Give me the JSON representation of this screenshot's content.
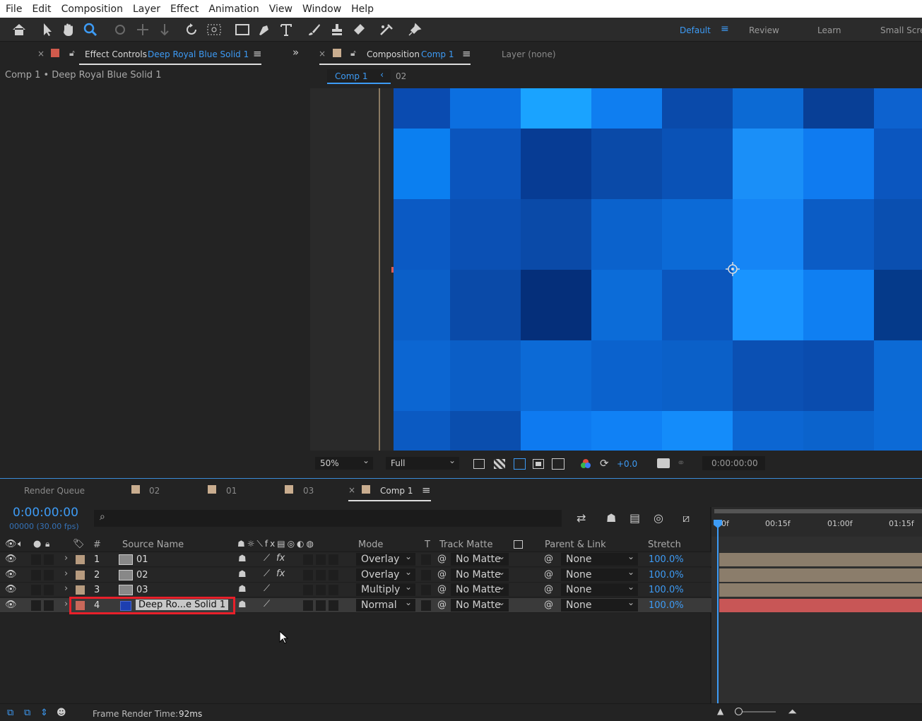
{
  "menu": [
    "File",
    "Edit",
    "Composition",
    "Layer",
    "Effect",
    "Animation",
    "View",
    "Window",
    "Help"
  ],
  "workspaces": {
    "default": "Default",
    "review": "Review",
    "learn": "Learn",
    "small_screen": "Small Scre"
  },
  "effect_controls": {
    "tab_label": "Effect Controls",
    "tab_layer": "Deep Royal Blue Solid 1",
    "breadcrumb": "Comp 1 • Deep Royal Blue Solid 1"
  },
  "composition": {
    "tab_label": "Composition",
    "tab_comp": "Comp 1",
    "layer_tab": "Layer (none)",
    "crumb_active": "Comp 1",
    "crumb_next": "02",
    "zoom": "50%",
    "resolution": "Full",
    "exposure": "+0.0",
    "timecode": "0:00:00:00"
  },
  "timeline": {
    "tabs": [
      "Render Queue",
      "02",
      "01",
      "03",
      "Comp 1"
    ],
    "timecode": "0:00:00:00",
    "frames": "00000 (30.00 fps)",
    "search_placeholder": "⌕",
    "ruler": [
      "0f",
      "00:15f",
      "01:00f",
      "01:15f"
    ],
    "columns": {
      "hash": "#",
      "source": "Source Name",
      "mode": "Mode",
      "t": "T",
      "track_matte": "Track Matte",
      "parent": "Parent & Link",
      "stretch": "Stretch"
    },
    "layers": [
      {
        "num": "1",
        "name": "01",
        "mode": "Overlay",
        "matte": "No Matte",
        "parent": "None",
        "stretch": "100.0%",
        "label_color": "#b79b7f",
        "fx": "fx"
      },
      {
        "num": "2",
        "name": "02",
        "mode": "Overlay",
        "matte": "No Matte",
        "parent": "None",
        "stretch": "100.0%",
        "label_color": "#b79b7f",
        "fx": "fx"
      },
      {
        "num": "3",
        "name": "03",
        "mode": "Multiply",
        "matte": "No Matte",
        "parent": "None",
        "stretch": "100.0%",
        "label_color": "#b79b7f",
        "fx": ""
      },
      {
        "num": "4",
        "name": "Deep Ro...e Solid 1",
        "mode": "Normal",
        "matte": "No Matte",
        "parent": "None",
        "stretch": "100.0%",
        "label_color": "#c9685a",
        "fx": ""
      }
    ],
    "status_label": "Frame Render Time:",
    "status_value": "92ms"
  },
  "colors": {
    "accent": "#3d9bf5",
    "selection": "#e8202a",
    "track_bar": "#8b7d6b",
    "track_bar_selected": "#c85656"
  }
}
